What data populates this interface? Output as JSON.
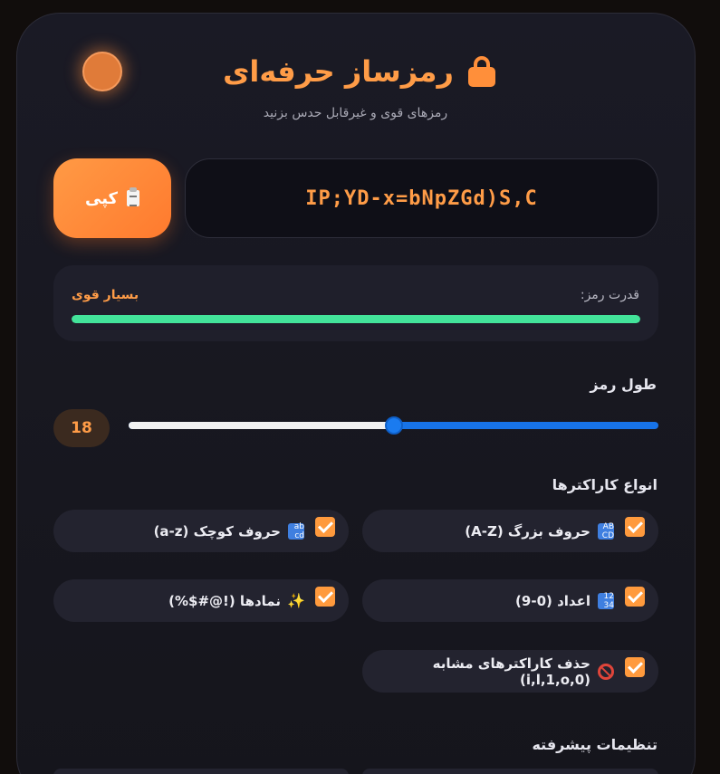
{
  "header": {
    "title": "رمزساز حرفه‌ای",
    "subtitle": "رمزهای قوی و غیرقابل حدس بزنید"
  },
  "password": {
    "value": "IP;YD-x=bNpZGd)S,C",
    "copy_label": "کپی"
  },
  "strength": {
    "label": "قدرت رمز:",
    "value": "بسیار قوی",
    "level_fraction": 1.0,
    "color": "#43e39a"
  },
  "length": {
    "title": "طول رمز",
    "value": "18",
    "slider_fraction": 0.5
  },
  "char_types": {
    "title": "انواع کاراکترها",
    "options": [
      {
        "label": "حروف بزرگ (A-Z)",
        "icon": "uppercase-abcd-icon",
        "icon_text": "AB CD",
        "checked": true
      },
      {
        "label": "حروف کوچک (a-z)",
        "icon": "lowercase-abcd-icon",
        "icon_text": "ab cd",
        "checked": true
      },
      {
        "label": "اعداد (0-9)",
        "icon": "numbers-1234-icon",
        "icon_text": "12 34",
        "checked": true
      },
      {
        "label": "نمادها (!@#$%)",
        "icon": "sparkles-icon",
        "icon_text": "✨",
        "checked": true
      },
      {
        "label": "حذف کاراکترهای مشابه (i,l,1,o,0)",
        "icon": "no-entry-icon",
        "icon_text": "",
        "checked": true
      }
    ]
  },
  "advanced": {
    "title": "تنظیمات پیشرفته"
  },
  "colors": {
    "accent": "#ff9c47",
    "slider": "#1773e8"
  }
}
